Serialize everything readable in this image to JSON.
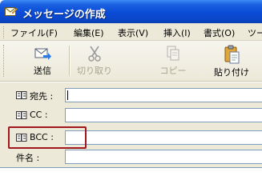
{
  "window": {
    "title": "メッセージの作成",
    "icon": "envelope-edit-icon"
  },
  "menu": {
    "items": [
      {
        "label": "ファイル(F)"
      },
      {
        "label": "編集(E)"
      },
      {
        "label": "表示(V)"
      },
      {
        "label": "挿入(I)"
      },
      {
        "label": "書式(O)"
      },
      {
        "label": "ツー"
      }
    ]
  },
  "toolbar": {
    "buttons": [
      {
        "label": "送信",
        "icon": "send-icon",
        "enabled": true
      },
      {
        "label": "切り取り",
        "icon": "scissors-icon",
        "enabled": false
      },
      {
        "label": "コピー",
        "icon": "copy-icon",
        "enabled": false
      },
      {
        "label": "貼り付け",
        "icon": "paste-icon",
        "enabled": true
      }
    ]
  },
  "fields": [
    {
      "label": "宛先 :",
      "icon": "address-book-icon",
      "value": ""
    },
    {
      "label": "CC :",
      "icon": "address-book-icon",
      "value": ""
    },
    {
      "label": "BCC :",
      "icon": "address-book-icon",
      "value": ""
    },
    {
      "label": "件名 :",
      "icon": "",
      "value": ""
    }
  ],
  "colors": {
    "title_bar": "#0a4bd6",
    "highlight": "#a0181c",
    "chrome": "#ece9d8"
  }
}
